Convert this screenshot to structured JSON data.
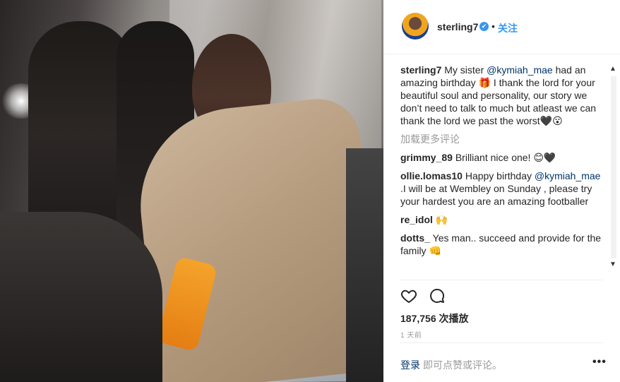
{
  "header": {
    "username": "sterling7",
    "verified_mark": "✔",
    "separator": "•",
    "follow_label": "关注"
  },
  "caption": {
    "username": "sterling7",
    "text_1": "My sister ",
    "mention": "@kymiah_mae",
    "text_2": " had an amazing birthday 🎁 I thank the lord for your beautiful soul and personality, our story we don’t need to talk to much but atleast we can thank the lord we past the worst🖤😮"
  },
  "load_more_label": "加载更多评论",
  "comments": [
    {
      "username": "grimmy_89",
      "text": "Brilliant nice one! 😊🖤"
    },
    {
      "username": "ollie.lomas10",
      "text_1": "Happy birthday ",
      "mention": "@kymiah_mae",
      "text_2": " .I will be at Wembley on Sunday , please try your hardest you are an amazing footballer"
    },
    {
      "username": "re_idol",
      "text": "🙌"
    },
    {
      "username": "dotts_",
      "text": "Yes man.. succeed and provide for the family 👊"
    }
  ],
  "actions": {
    "like_icon": "heart-icon",
    "comment_icon": "comment-bubble-icon"
  },
  "views": "187,756 次播放",
  "timestamp": "1 天前",
  "footer": {
    "login_label": "登录",
    "comment_hint": "即可点赞或评论。",
    "more_label": "•••"
  },
  "colors": {
    "accent": "#3897f0",
    "link": "#003569",
    "muted": "#999999"
  }
}
